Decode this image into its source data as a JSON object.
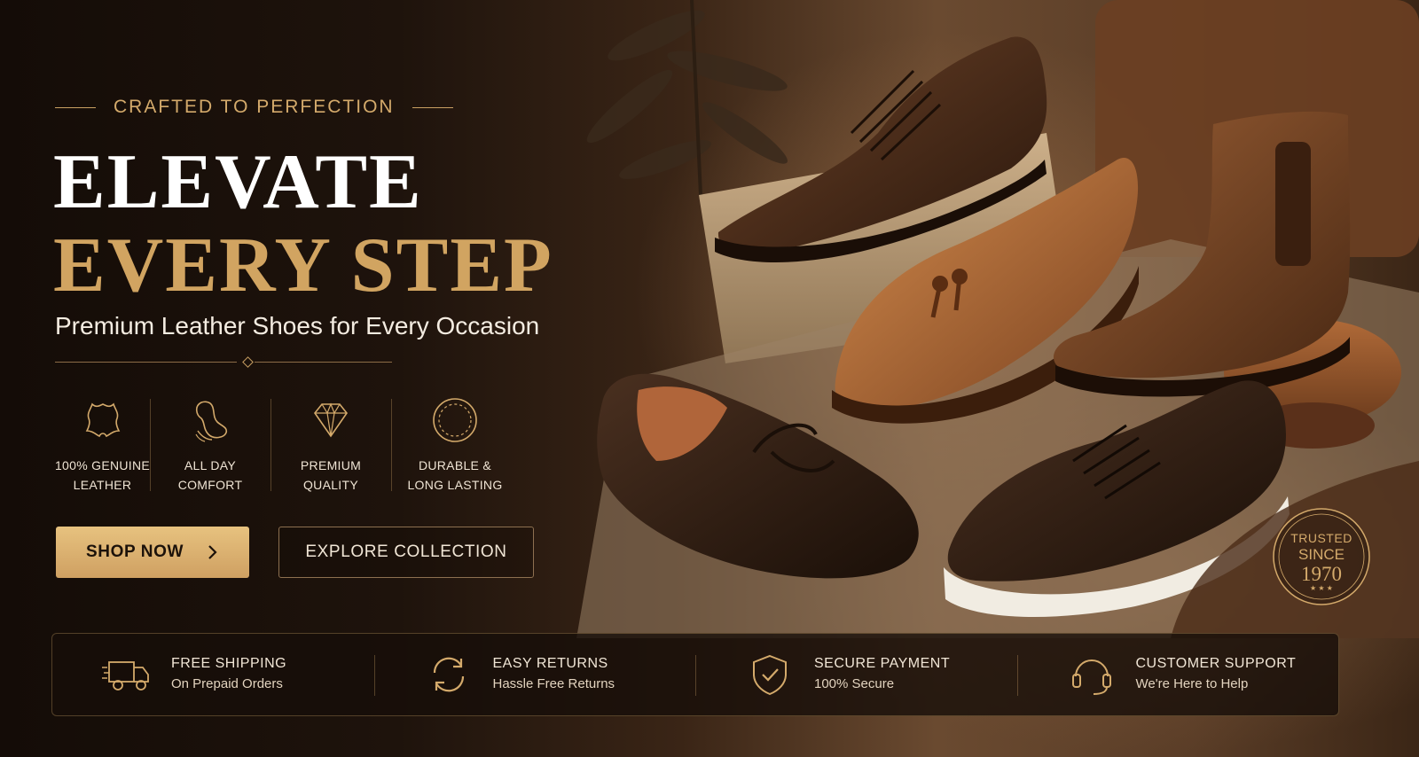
{
  "hero": {
    "eyebrow": "CRAFTED TO PERFECTION",
    "title_line1": "ELEVATE",
    "title_line2": "EVERY STEP",
    "subtitle": "Premium Leather Shoes for Every Occasion"
  },
  "features": [
    {
      "icon": "leather-hide-icon",
      "line1": "100% GENUINE",
      "line2": "LEATHER"
    },
    {
      "icon": "comfort-insole-icon",
      "line1": "ALL DAY",
      "line2": "COMFORT"
    },
    {
      "icon": "diamond-icon",
      "line1": "PREMIUM",
      "line2": "QUALITY"
    },
    {
      "icon": "durable-badge-icon",
      "line1": "DURABLE &",
      "line2": "LONG LASTING"
    }
  ],
  "buttons": {
    "shop_now": "SHOP NOW",
    "explore": "EXPLORE COLLECTION"
  },
  "badge": {
    "line1": "TRUSTED",
    "line2": "SINCE",
    "line3": "1970"
  },
  "benefits": [
    {
      "icon": "delivery-truck-icon",
      "title": "FREE SHIPPING",
      "subtitle": "On Prepaid Orders"
    },
    {
      "icon": "returns-icon",
      "title": "EASY RETURNS",
      "subtitle": "Hassle Free Returns"
    },
    {
      "icon": "secure-shield-icon",
      "title": "SECURE PAYMENT",
      "subtitle": "100% Secure"
    },
    {
      "icon": "headset-icon",
      "title": "CUSTOMER SUPPORT",
      "subtitle": "We're Here to Help"
    }
  ],
  "colors": {
    "accent_gold": "#d1a461",
    "background_dark": "#1a110b"
  }
}
